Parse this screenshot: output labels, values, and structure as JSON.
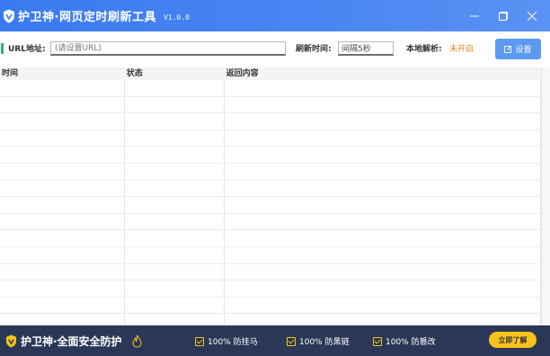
{
  "window": {
    "title": "护卫神·网页定时刷新工具",
    "version": "V1.0.0",
    "controls": [
      "minimize",
      "maximize",
      "close"
    ]
  },
  "toolbar": {
    "url_label": "URL地址:",
    "url_placeholder": "(请设置URL)",
    "refresh_label": "刷新时间:",
    "refresh_value": "间隔5秒",
    "resolve_label": "本地解析:",
    "resolve_status": "未开启",
    "settings_label": "设置"
  },
  "table": {
    "columns": [
      "时间",
      "状态",
      "返回内容"
    ],
    "rows": []
  },
  "banner": {
    "title": "护卫神·全面安全防护",
    "features": [
      "100% 防挂马",
      "100% 防黑链",
      "100% 防篡改"
    ],
    "cta_label": "立即了解"
  },
  "colors": {
    "titlebar": "#3a7af0",
    "accent_green": "#2fb36b",
    "status_orange": "#e08a1a",
    "settings_button": "#5c9af2",
    "banner_bg": "#2a3756",
    "banner_yellow": "#f7c21c"
  }
}
